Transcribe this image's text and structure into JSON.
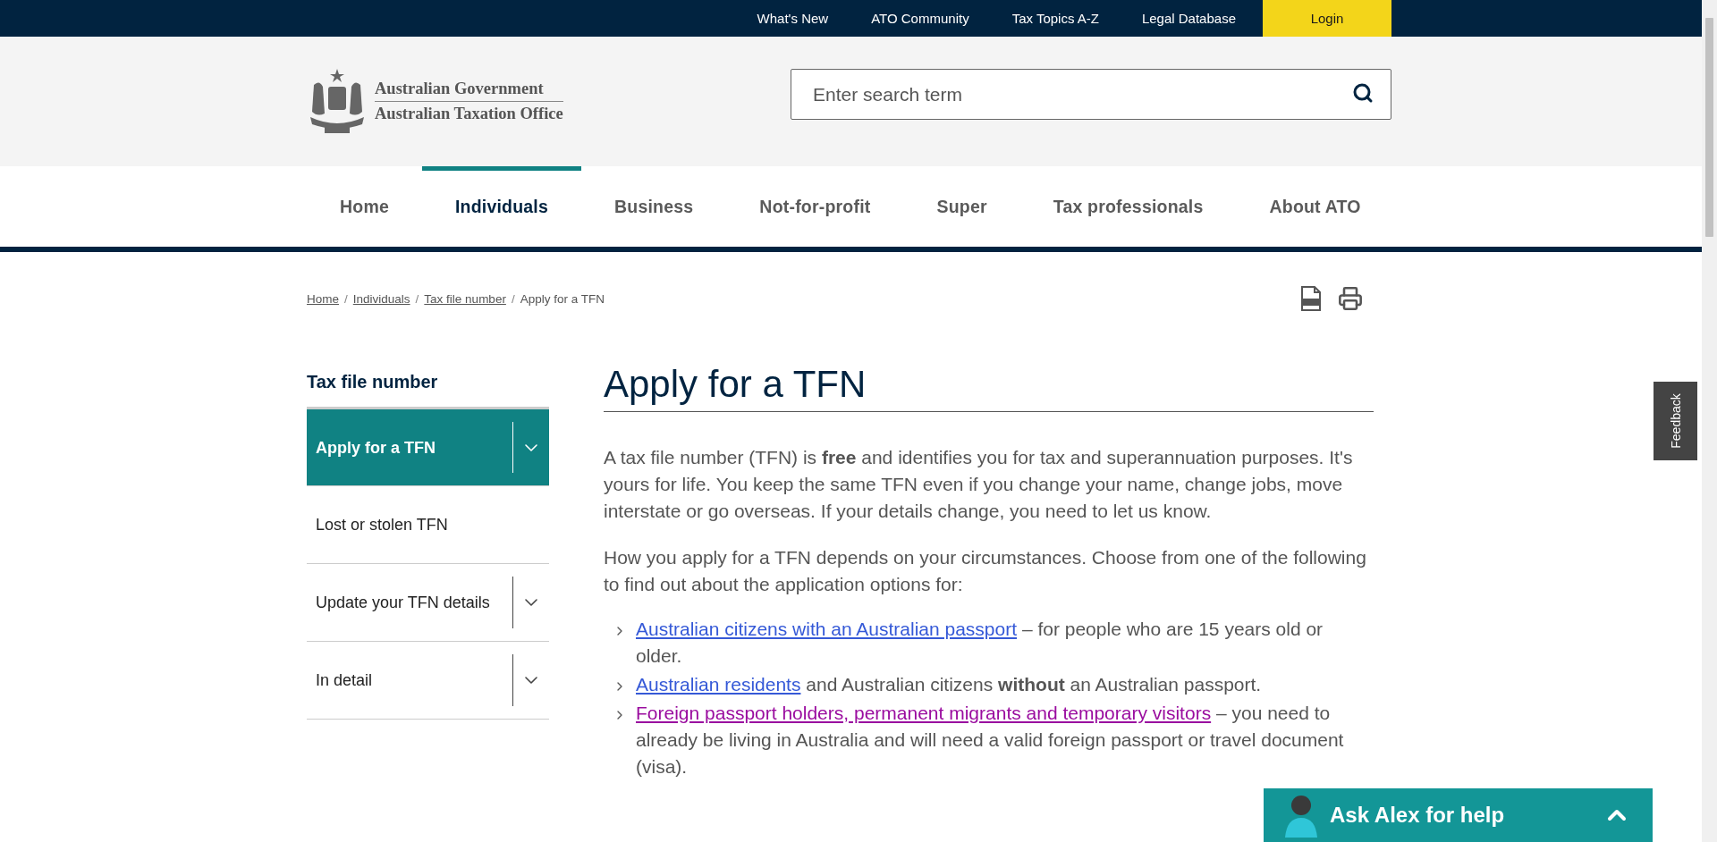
{
  "top_links": [
    {
      "label": "What's New"
    },
    {
      "label": "ATO Community"
    },
    {
      "label": "Tax Topics A-Z"
    },
    {
      "label": "Legal Database"
    }
  ],
  "login": "Login",
  "logo": {
    "line1": "Australian Government",
    "line2": "Australian Taxation Office"
  },
  "search": {
    "placeholder": "Enter search term"
  },
  "nav": [
    {
      "label": "Home",
      "selected": false
    },
    {
      "label": "Individuals",
      "selected": true
    },
    {
      "label": "Business",
      "selected": false
    },
    {
      "label": "Not-for-profit",
      "selected": false
    },
    {
      "label": "Super",
      "selected": false
    },
    {
      "label": "Tax professionals",
      "selected": false
    },
    {
      "label": "About ATO",
      "selected": false
    }
  ],
  "breadcrumb_separator": "/",
  "breadcrumb": [
    {
      "label": "Home",
      "kind": "link"
    },
    {
      "label": "Individuals",
      "kind": "link"
    },
    {
      "label": "Tax file number",
      "kind": "link"
    },
    {
      "label": "Apply for a TFN",
      "kind": "current"
    }
  ],
  "sidebar": {
    "title": "Tax file number",
    "items": [
      {
        "label": "Apply for a TFN",
        "selected": true,
        "expandable": true
      },
      {
        "label": "Lost or stolen TFN",
        "selected": false,
        "expandable": false
      },
      {
        "label": "Update your TFN details",
        "selected": false,
        "expandable": true
      },
      {
        "label": "In detail",
        "selected": false,
        "expandable": true
      }
    ]
  },
  "article": {
    "title": "Apply for a TFN",
    "paragraphs": [
      "A tax file number (TFN) is **free** and identifies you for tax and superannuation purposes. It's yours for life. You keep the same TFN even if you change your name, change jobs, move interstate or go overseas. If your details change, you need to let us know.",
      "How you apply for a TFN depends on your circumstances. Choose from one of the following to find out about the application options for:"
    ],
    "options": [
      {
        "link": "Australian citizens with an Australian passport",
        "visited": false,
        "text": " – for people who are 15  years old or older."
      },
      {
        "link": "Australian residents",
        "visited": false,
        "text": " and Australian citizens **without** an Australian passport."
      },
      {
        "link": "Foreign passport holders, permanent migrants and temporary visitors",
        "visited": true,
        "text": " – you need to already be living in Australia and will need a valid foreign passport or travel document (visa)."
      }
    ]
  },
  "feedback": "Feedback",
  "chat": {
    "label": "Ask Alex for help"
  }
}
